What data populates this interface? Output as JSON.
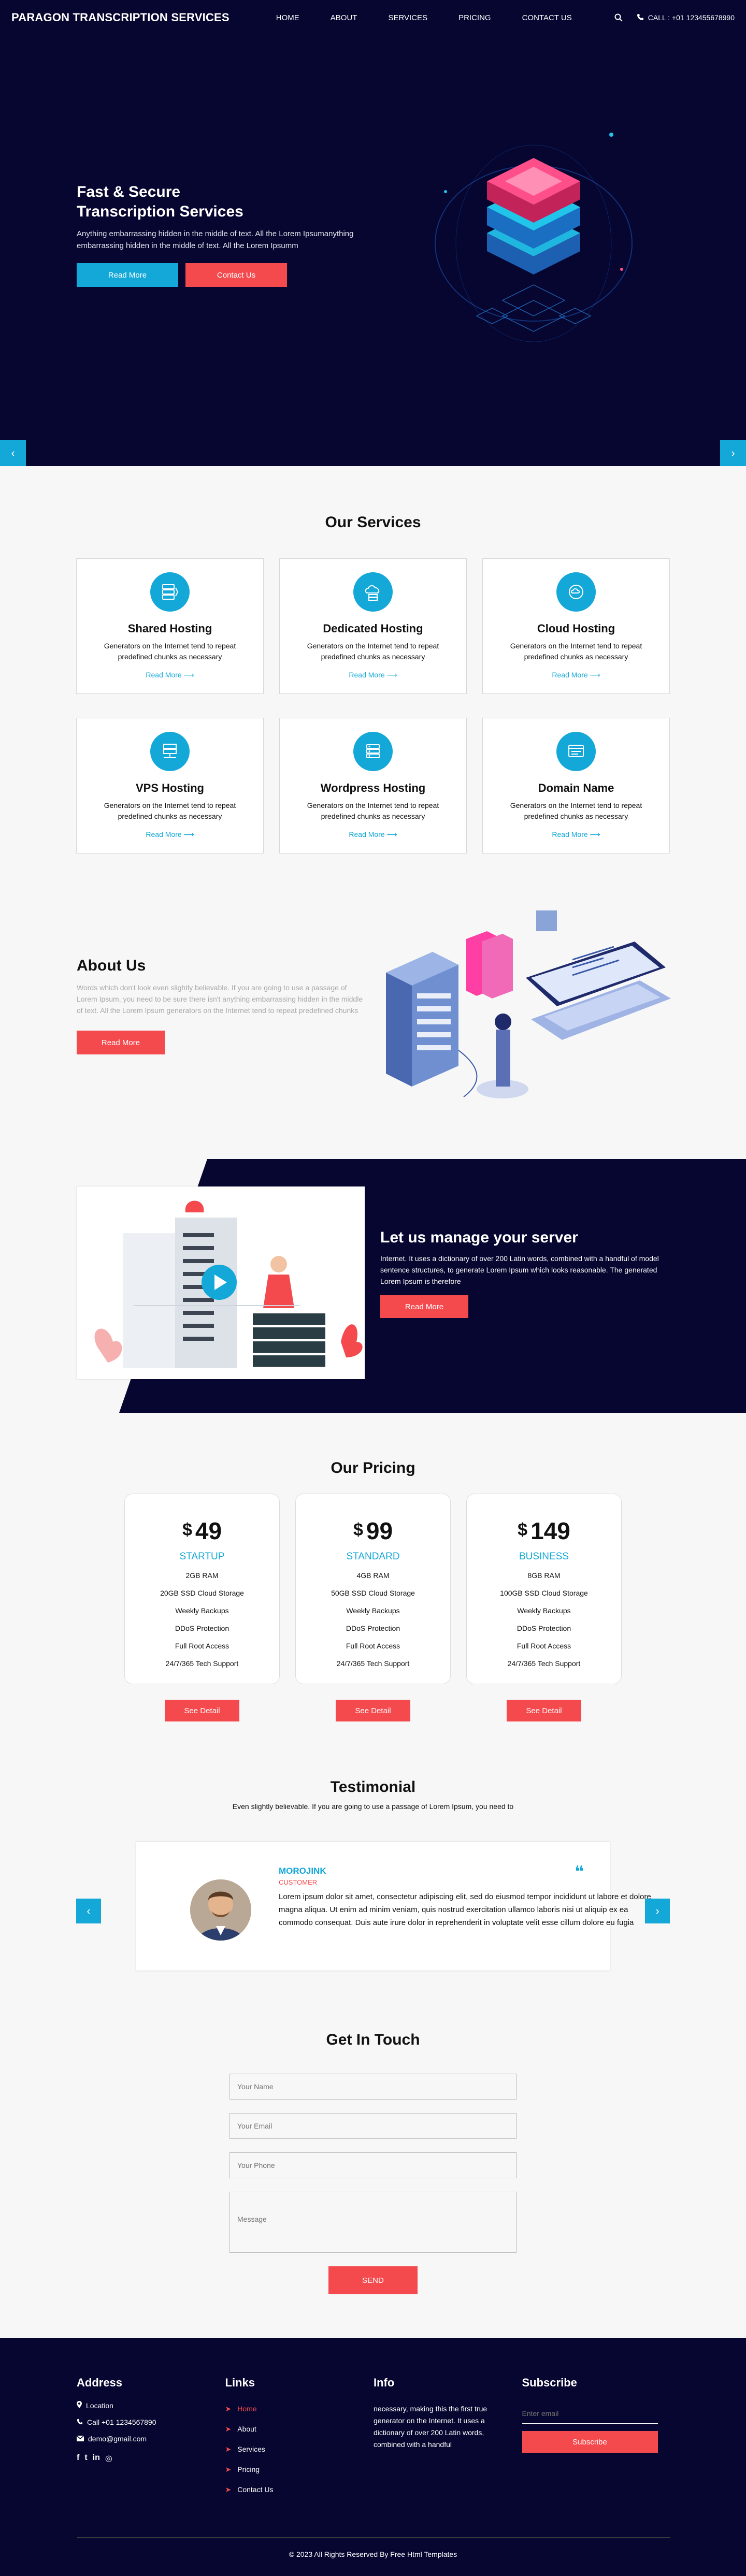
{
  "header": {
    "brand": "PARAGON TRANSCRIPTION SERVICES",
    "menu": [
      "HOME",
      "ABOUT",
      "SERVICES",
      "PRICING",
      "CONTACT US"
    ],
    "call": "CALL : +01 123455678990"
  },
  "hero": {
    "title_line1": "Fast & Secure",
    "title_line2": "Transcription Services",
    "text": "Anything embarrassing hidden in the middle of text. All the Lorem Ipsumanything embarrassing hidden in the middle of text. All the Lorem Ipsumm",
    "btn_primary": "Read More",
    "btn_secondary": "Contact Us",
    "arrow_left": "‹",
    "arrow_right": "›"
  },
  "services": {
    "title": "Our Services",
    "items": [
      {
        "name": "Shared Hosting",
        "desc": "Generators on the Internet tend to repeat predefined chunks as necessary",
        "link": "Read More ⟶"
      },
      {
        "name": "Dedicated Hosting",
        "desc": "Generators on the Internet tend to repeat predefined chunks as necessary",
        "link": "Read More ⟶"
      },
      {
        "name": "Cloud Hosting",
        "desc": "Generators on the Internet tend to repeat predefined chunks as necessary",
        "link": "Read More ⟶"
      },
      {
        "name": "VPS Hosting",
        "desc": "Generators on the Internet tend to repeat predefined chunks as necessary",
        "link": "Read More ⟶"
      },
      {
        "name": "Wordpress Hosting",
        "desc": "Generators on the Internet tend to repeat predefined chunks as necessary",
        "link": "Read More ⟶"
      },
      {
        "name": "Domain Name",
        "desc": "Generators on the Internet tend to repeat predefined chunks as necessary",
        "link": "Read More ⟶"
      }
    ]
  },
  "about": {
    "title": "About Us",
    "text": "Words which don't look even slightly believable. If you are going to use a passage of Lorem Ipsum, you need to be sure there isn't anything embarrassing hidden in the middle of text. All the Lorem Ipsum generators on the Internet tend to repeat predefined chunks",
    "btn": "Read More"
  },
  "manage": {
    "title": "Let us manage your server",
    "text": "Internet. It uses a dictionary of over 200 Latin words, combined with a handful of model sentence structures, to generate Lorem Ipsum which looks reasonable. The generated Lorem Ipsum is therefore",
    "btn": "Read More"
  },
  "pricing": {
    "title": "Our Pricing",
    "currency": "$",
    "plans": [
      {
        "price": "49",
        "name": "STARTUP",
        "features": [
          "2GB RAM",
          "20GB SSD Cloud Storage",
          "Weekly Backups",
          "DDoS Protection",
          "Full Root Access",
          "24/7/365 Tech Support"
        ],
        "btn": "See Detail"
      },
      {
        "price": "99",
        "name": "STANDARD",
        "features": [
          "4GB RAM",
          "50GB SSD Cloud Storage",
          "Weekly Backups",
          "DDoS Protection",
          "Full Root Access",
          "24/7/365 Tech Support"
        ],
        "btn": "See Detail"
      },
      {
        "price": "149",
        "name": "BUSINESS",
        "features": [
          "8GB RAM",
          "100GB SSD Cloud Storage",
          "Weekly Backups",
          "DDoS Protection",
          "Full Root Access",
          "24/7/365 Tech Support"
        ],
        "btn": "See Detail"
      }
    ]
  },
  "testimonial": {
    "title": "Testimonial",
    "subtitle": "Even slightly believable. If you are going to use a passage of Lorem Ipsum, you need to",
    "name": "MOROJINK",
    "role": "CUSTOMER",
    "text": "Lorem ipsum dolor sit amet, consectetur adipiscing elit, sed do eiusmod tempor incididunt ut labore et dolore magna aliqua. Ut enim ad minim veniam, quis nostrud exercitation ullamco laboris nisi ut aliquip ex ea commodo consequat. Duis aute irure dolor in reprehenderit in voluptate velit esse cillum dolore eu fugia",
    "quote": "❝",
    "arrow_left": "‹",
    "arrow_right": "›"
  },
  "contact": {
    "title": "Get In Touch",
    "name_placeholder": "Your Name",
    "email_placeholder": "Your Email",
    "phone_placeholder": "Your Phone",
    "message_placeholder": "Message",
    "send": "SEND"
  },
  "footer": {
    "address_title": "Address",
    "location": "Location",
    "phone": "Call +01 1234567890",
    "email": "demo@gmail.com",
    "social": [
      "f",
      "t",
      "in",
      "◎"
    ],
    "links_title": "Links",
    "links": [
      "Home",
      "About",
      "Services",
      "Pricing",
      "Contact Us"
    ],
    "info_title": "Info",
    "info_text": "necessary, making this the first true generator on the Internet. It uses a dictionary of over 200 Latin words, combined with a handful",
    "subscribe_title": "Subscribe",
    "subscribe_placeholder": "Enter email",
    "subscribe_btn": "Subscribe",
    "copyright": "© 2023 All Rights Reserved By Free Html Templates"
  },
  "colors": {
    "navy": "#060630",
    "accent_blue": "#13a8d8",
    "accent_red": "#f44a4e"
  }
}
